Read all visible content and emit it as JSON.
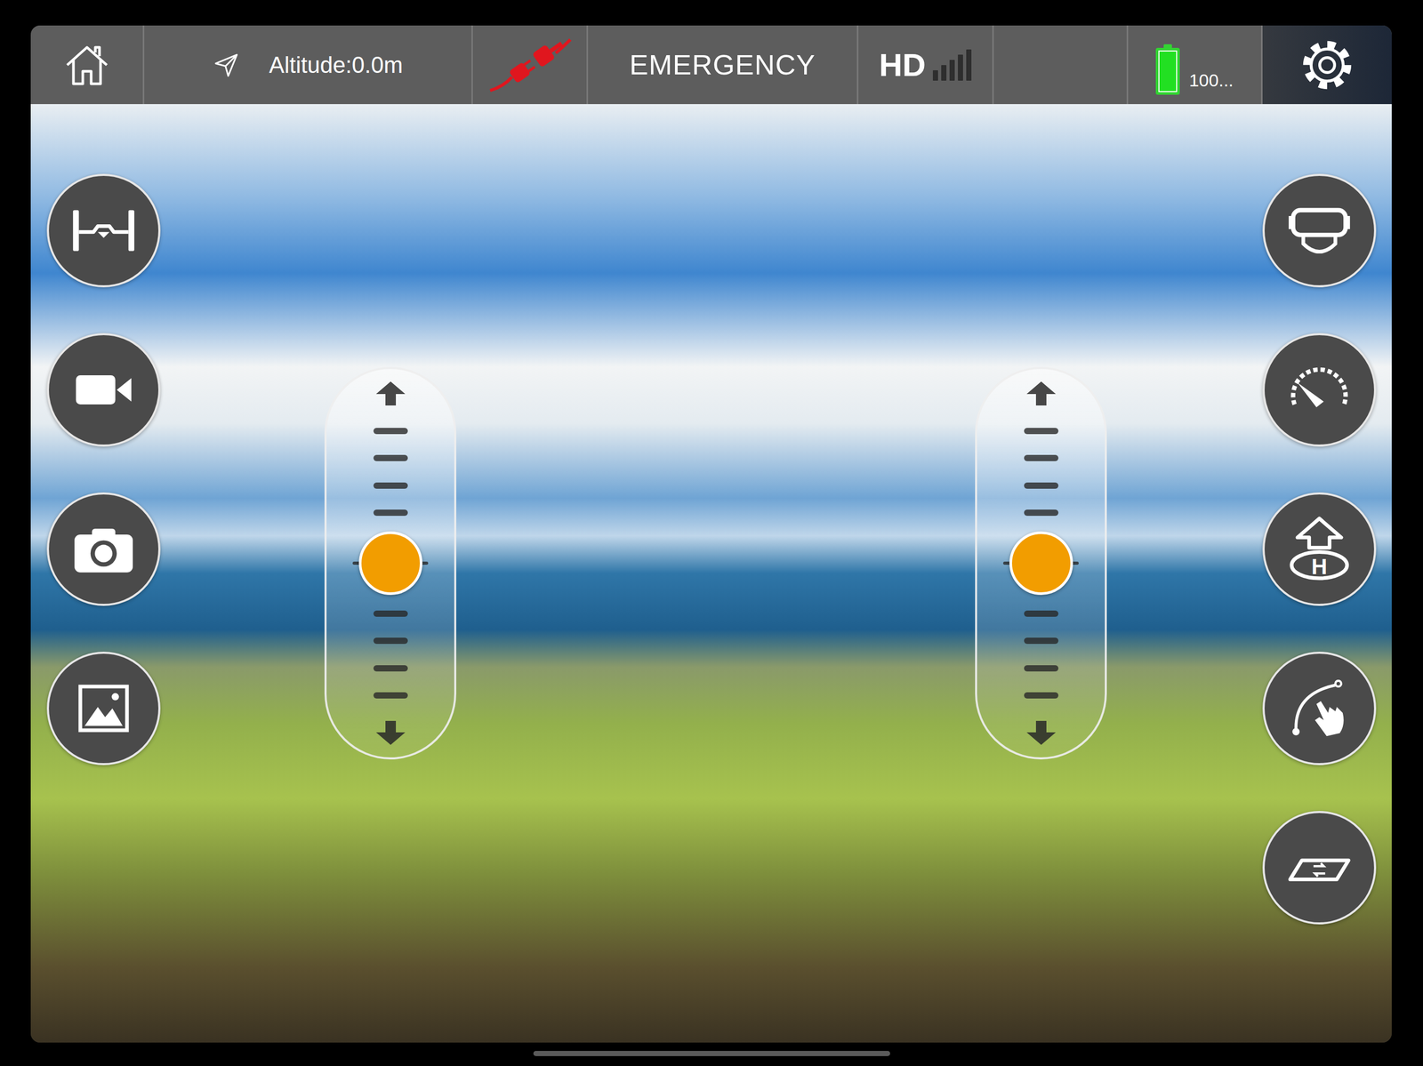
{
  "status_bar": {
    "altitude": "Altitude:0.0m",
    "connected": false,
    "emergency": "EMERGENCY",
    "video_quality": "HD",
    "signal_level": 0,
    "battery_level": 1,
    "battery_text": "100..."
  },
  "takeoff_icon_glyph": "H",
  "sliders": [
    {
      "level": 0.5
    },
    {
      "level": 0.5
    }
  ]
}
